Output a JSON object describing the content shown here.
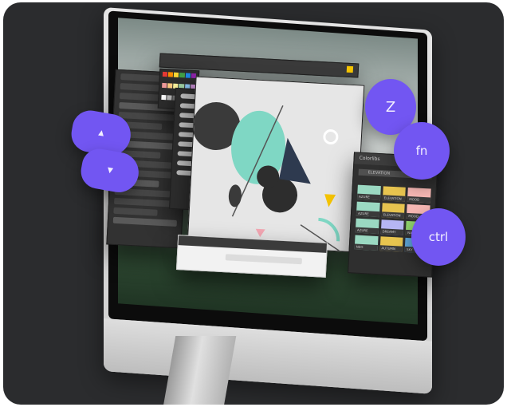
{
  "keys": {
    "up": "▲",
    "down": "▼",
    "z": "Z",
    "fn": "fn",
    "ctrl": "ctrl"
  },
  "colors_panel": {
    "title": "Colorlibs",
    "search": "ELEVATION",
    "swatches": [
      {
        "color": "#9bd9c2",
        "label": "AZURE"
      },
      {
        "color": "#e7c44f",
        "label": "ELEVATION"
      },
      {
        "color": "#f6b7b3",
        "label": "MOOD"
      },
      {
        "color": "#9bd9c2",
        "label": "AZURE"
      },
      {
        "color": "#e7c44f",
        "label": "ELEVATION"
      },
      {
        "color": "#f6b7b3",
        "label": "MOOD"
      },
      {
        "color": "#9bd9c2",
        "label": "AZURE"
      },
      {
        "color": "#b6b6f3",
        "label": "DREAMY"
      },
      {
        "color": "#8fd36c",
        "label": "NATURAL"
      },
      {
        "color": "#9bd9c2",
        "label": "NEO"
      },
      {
        "color": "#e7c44f",
        "label": "AUTUMN"
      },
      {
        "color": "#5ea5d8",
        "label": "SKY"
      }
    ]
  },
  "colors": {
    "accent": "#7256f2",
    "teal": "#7fd7c4",
    "yellow": "#f5c400",
    "pink": "#f3a7b3",
    "dark_bg": "#2b2c2e"
  }
}
